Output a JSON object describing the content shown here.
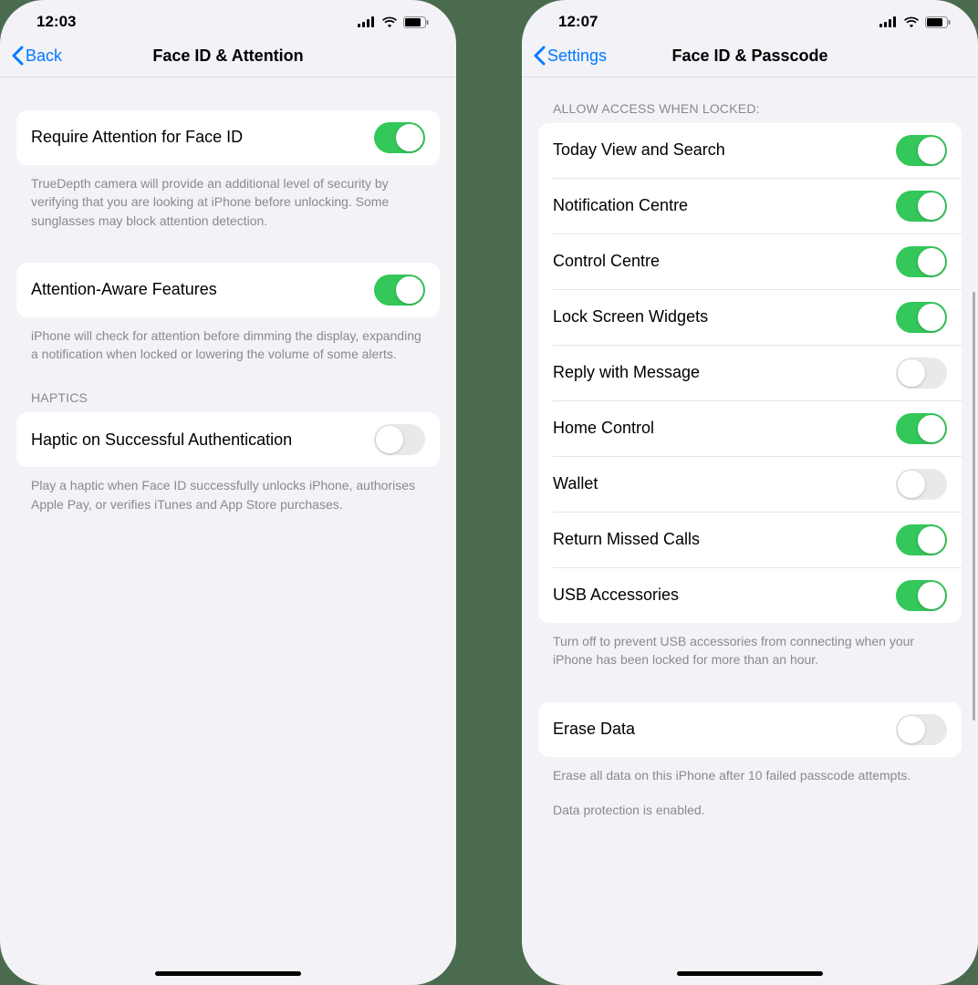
{
  "left": {
    "status": {
      "time": "12:03"
    },
    "nav": {
      "back": "Back",
      "title": "Face ID & Attention"
    },
    "items": [
      {
        "label": "Require Attention for Face ID",
        "on": true
      },
      {
        "label": "Attention-Aware Features",
        "on": true
      }
    ],
    "footer1": "TrueDepth camera will provide an additional level of security by verifying that you are looking at iPhone before unlocking. Some sunglasses may block attention detection.",
    "footer2": "iPhone will check for attention before dimming the display, expanding a notification when locked or lowering the volume of some alerts.",
    "haptics_header": "HAPTICS",
    "haptic_item": {
      "label": "Haptic on Successful Authentication",
      "on": false
    },
    "footer3": "Play a haptic when Face ID successfully unlocks iPhone, authorises Apple Pay, or verifies iTunes and App Store purchases."
  },
  "right": {
    "status": {
      "time": "12:07"
    },
    "nav": {
      "back": "Settings",
      "title": "Face ID & Passcode"
    },
    "section_header": "ALLOW ACCESS WHEN LOCKED:",
    "access_items": [
      {
        "label": "Today View and Search",
        "on": true
      },
      {
        "label": "Notification Centre",
        "on": true
      },
      {
        "label": "Control Centre",
        "on": true
      },
      {
        "label": "Lock Screen Widgets",
        "on": true
      },
      {
        "label": "Reply with Message",
        "on": false
      },
      {
        "label": "Home Control",
        "on": true
      },
      {
        "label": "Wallet",
        "on": false
      },
      {
        "label": "Return Missed Calls",
        "on": true
      },
      {
        "label": "USB Accessories",
        "on": true
      }
    ],
    "usb_footer": "Turn off to prevent USB accessories from connecting when your iPhone has been locked for more than an hour.",
    "erase": {
      "label": "Erase Data",
      "on": false
    },
    "erase_footer1": "Erase all data on this iPhone after 10 failed passcode attempts.",
    "erase_footer2": "Data protection is enabled."
  }
}
